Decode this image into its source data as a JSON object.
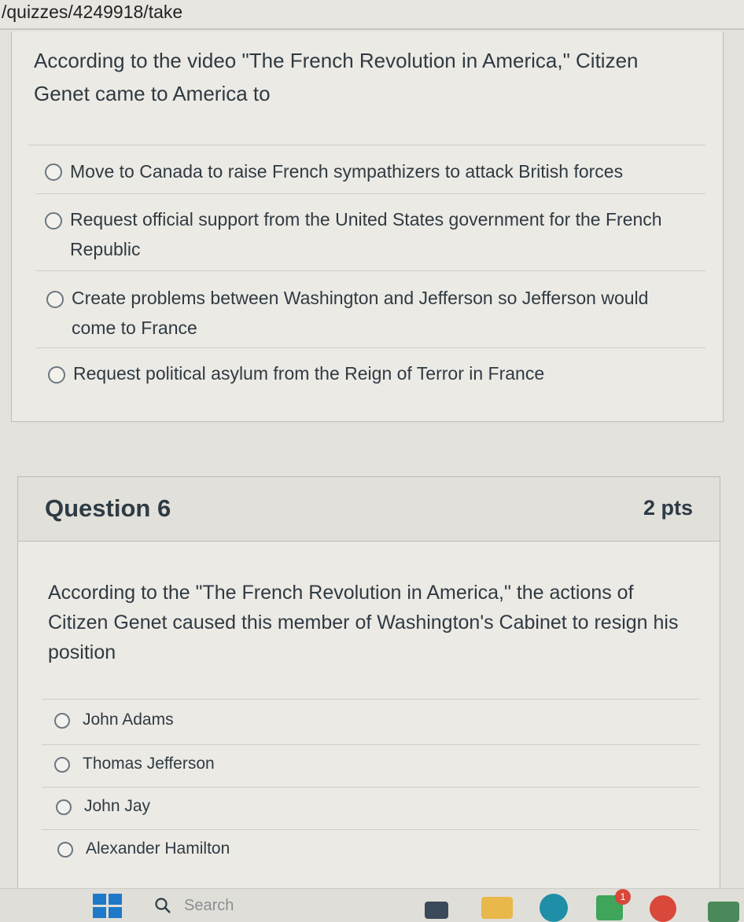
{
  "browser": {
    "url": "/quizzes/4249918/take"
  },
  "question5": {
    "text": "According to the video \"The French Revolution in America,\" Citizen Genet came to America to",
    "answers": [
      "Move to Canada to raise French sympathizers to attack British forces",
      "Request official support from the United States government for the French Republic",
      "Create problems between Washington and Jefferson so Jefferson would come to France",
      "Request political asylum from the Reign of Terror in France"
    ]
  },
  "question6": {
    "title": "Question 6",
    "points": "2 pts",
    "text": "According to the \"The French Revolution in America,\" the actions of Citizen Genet caused this member of Washington's Cabinet to resign his position",
    "answers": [
      "John Adams",
      "Thomas Jefferson",
      "John Jay",
      "Alexander Hamilton"
    ]
  },
  "taskbar": {
    "search_label": "Search",
    "notification_count": "1",
    "icons": [
      "windows-start-icon",
      "search-icon",
      "file-explorer-icon",
      "folder-icon",
      "edge-icon",
      "store-icon",
      "chrome-icon",
      "weather-icon"
    ]
  },
  "colors": {
    "page_bg": "#e4e2dc",
    "card_bg": "#eceae5",
    "header_bg": "#e2e0da",
    "text": "#2d3b45",
    "border": "#bdbbb5"
  }
}
